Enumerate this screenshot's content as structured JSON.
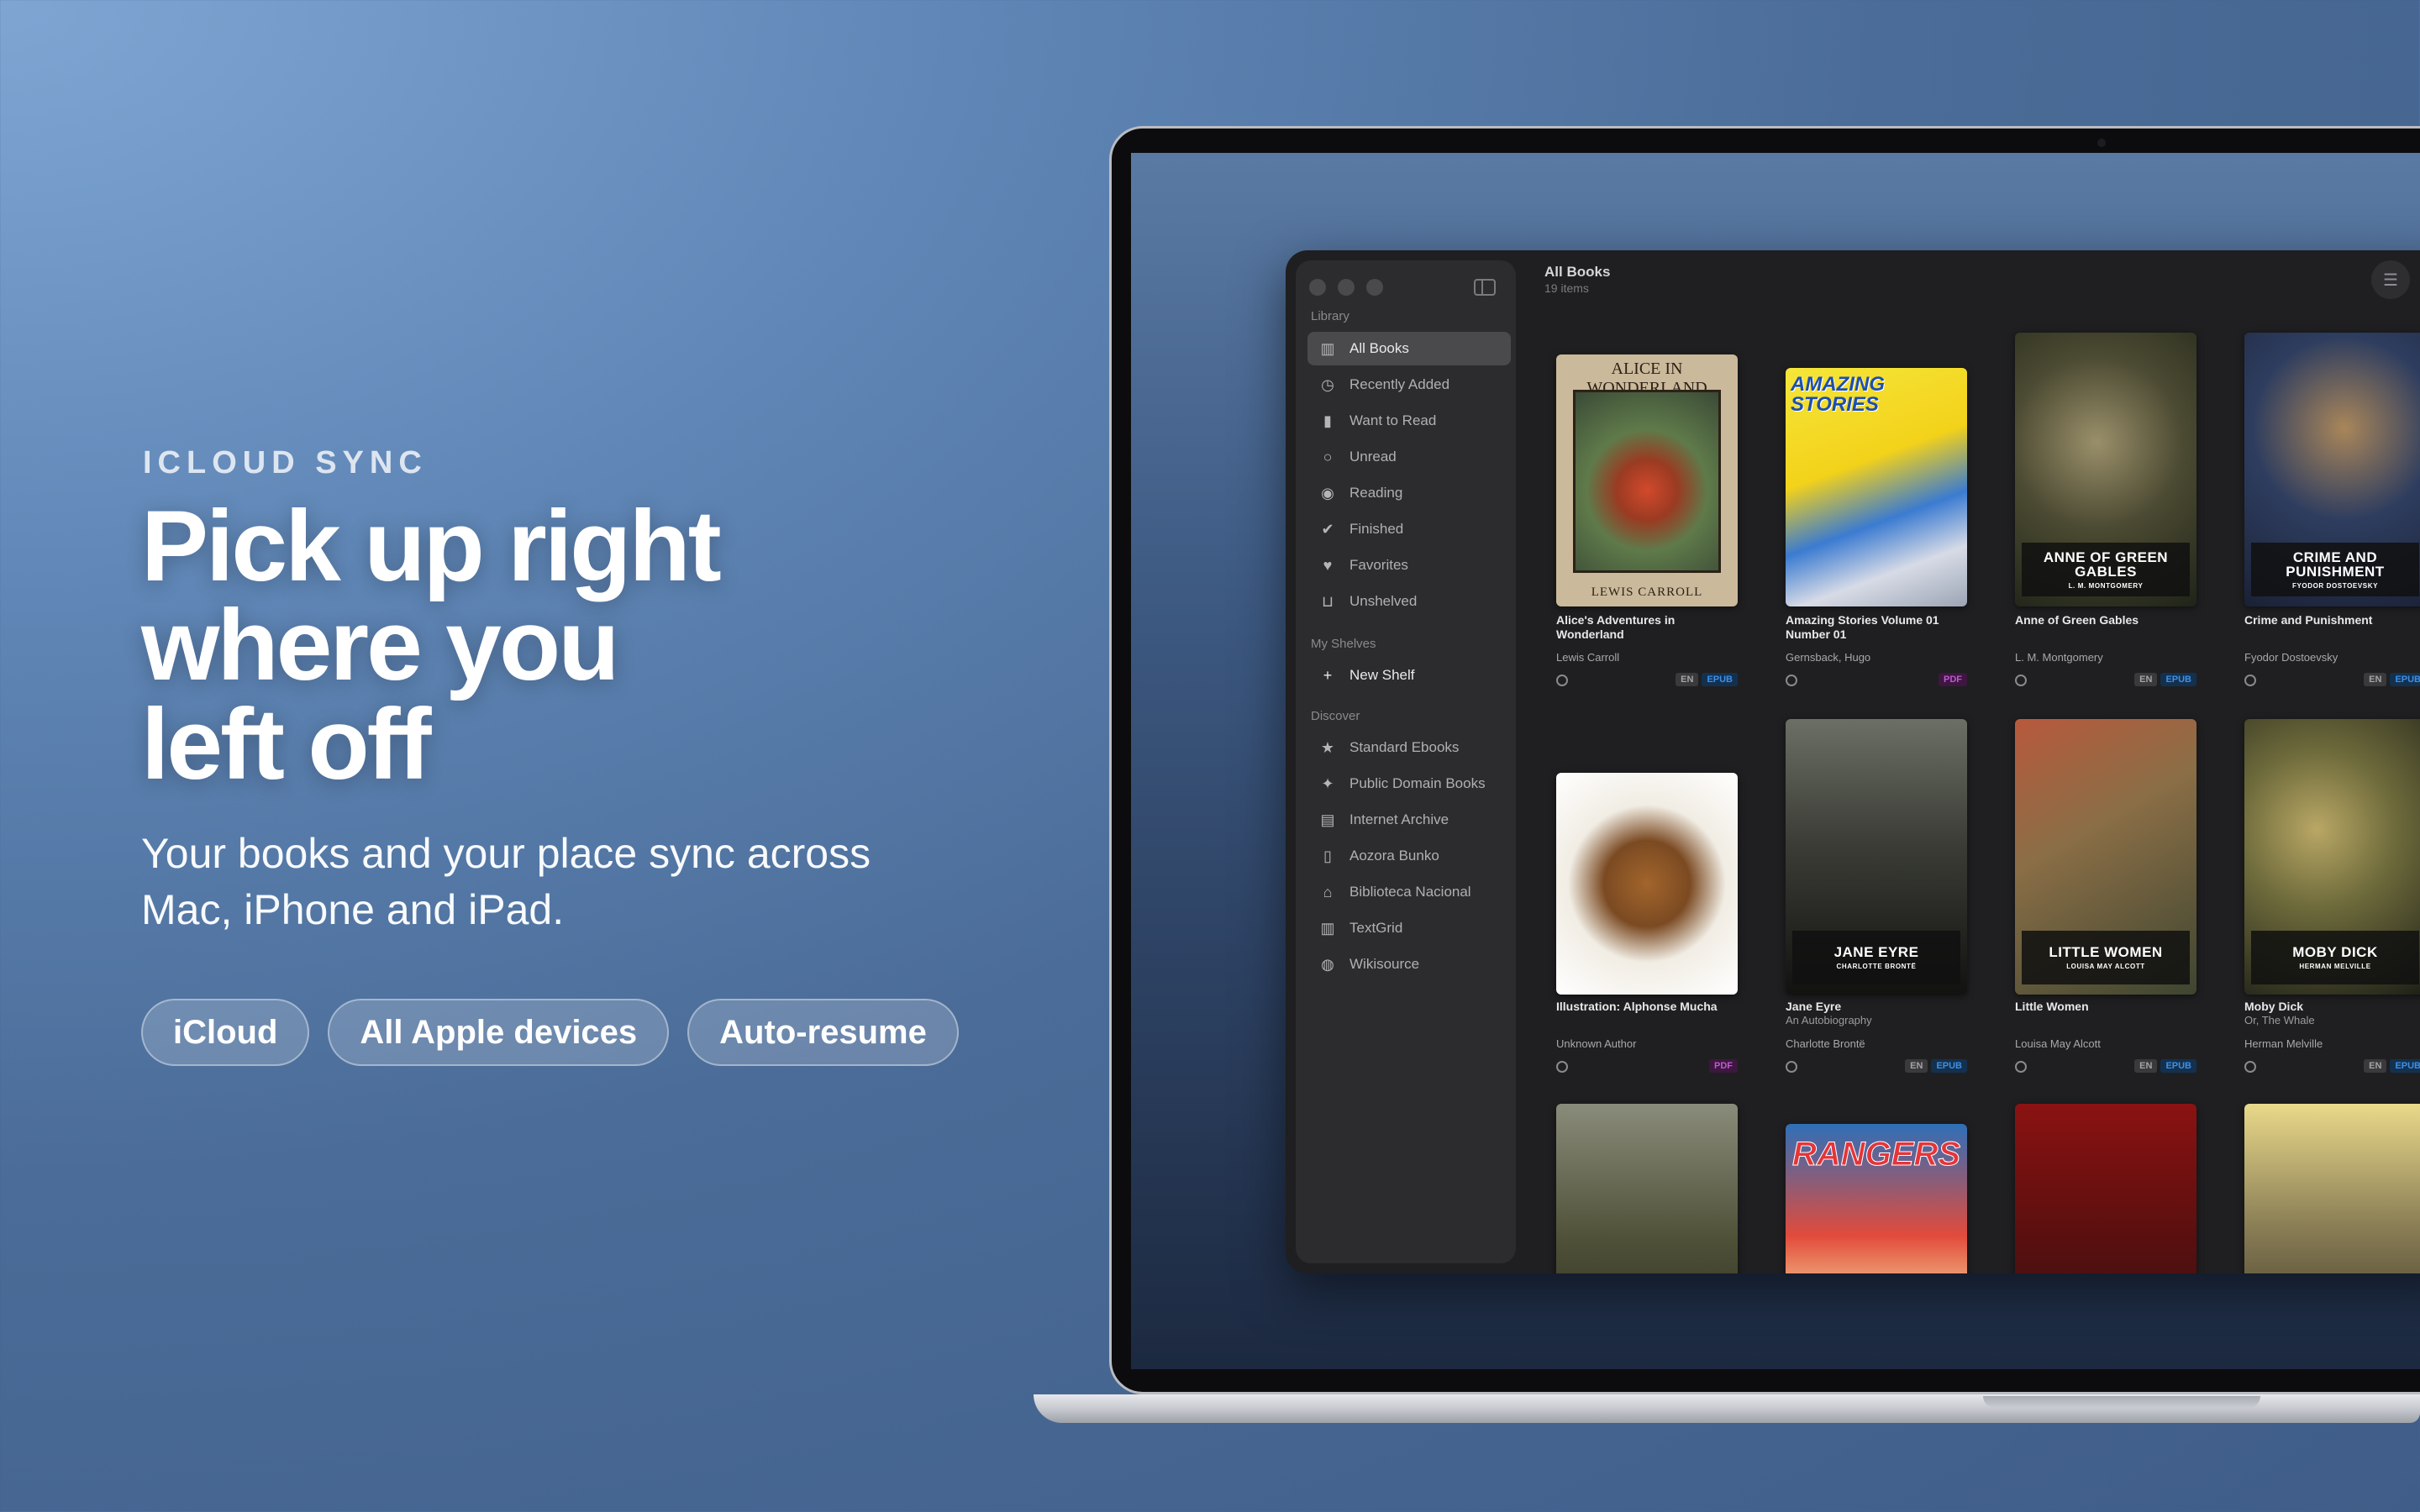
{
  "hero": {
    "eyebrow": "ICLOUD SYNC",
    "headline": [
      "Pick up right",
      "where you",
      "left off"
    ],
    "subtitle": [
      "Your books and your place sync across",
      "Mac, iPhone and iPad."
    ],
    "pills": [
      "iCloud",
      "All Apple devices",
      "Auto-resume"
    ]
  },
  "app": {
    "sidebar": {
      "library_heading": "Library",
      "library_items": [
        {
          "label": "All Books",
          "icon": "books-icon",
          "active": true
        },
        {
          "label": "Recently Added",
          "icon": "clock-icon"
        },
        {
          "label": "Want to Read",
          "icon": "bookmark-icon"
        },
        {
          "label": "Unread",
          "icon": "circle-icon"
        },
        {
          "label": "Reading",
          "icon": "reading-icon"
        },
        {
          "label": "Finished",
          "icon": "checkmark-icon"
        },
        {
          "label": "Favorites",
          "icon": "heart-icon"
        },
        {
          "label": "Unshelved",
          "icon": "tray-icon"
        }
      ],
      "shelves_heading": "My Shelves",
      "new_shelf": "New Shelf",
      "discover_heading": "Discover",
      "discover_items": [
        {
          "label": "Standard Ebooks",
          "icon": "star-icon"
        },
        {
          "label": "Public Domain Books",
          "icon": "sparkles-icon"
        },
        {
          "label": "Internet Archive",
          "icon": "archive-box-icon"
        },
        {
          "label": "Aozora Bunko",
          "icon": "book-icon"
        },
        {
          "label": "Biblioteca Nacional",
          "icon": "building-columns-icon"
        },
        {
          "label": "TextGrid",
          "icon": "library-icon"
        },
        {
          "label": "Wikisource",
          "icon": "globe-icon"
        }
      ]
    },
    "main": {
      "title": "All Books",
      "count": "19 items"
    },
    "books": [
      {
        "title": "Alice's Adventures in Wonderland",
        "subtitle": "",
        "author": "Lewis Carroll",
        "badges": [
          "EN",
          "EPUB"
        ],
        "cover_text": "ALICE IN WONDERLAND",
        "cover_footer": "LEWIS CARROLL"
      },
      {
        "title": "Amazing Stories Volume 01 Number 01",
        "subtitle": "",
        "author": "Gernsback, Hugo",
        "badges": [
          "PDF"
        ],
        "cover_text": "AMAZING STORIES"
      },
      {
        "title": "Anne of Green Gables",
        "subtitle": "",
        "author": "L. M. Montgomery",
        "badges": [
          "EN",
          "EPUB"
        ],
        "cover_text": "ANNE OF GREEN GABLES",
        "cover_author": "L. M. MONTGOMERY"
      },
      {
        "title": "Crime and Punishment",
        "subtitle": "",
        "author": "Fyodor Dostoevsky",
        "badges": [
          "EN",
          "EPUB"
        ],
        "cover_text": "CRIME AND PUNISHMENT",
        "cover_author": "FYODOR DOSTOEVSKY"
      },
      {
        "title": "Illustration: Alphonse Mucha",
        "subtitle": "",
        "author": "Unknown Author",
        "badges": [
          "PDF"
        ]
      },
      {
        "title": "Jane Eyre",
        "subtitle": "An Autobiography",
        "author": "Charlotte Brontë",
        "badges": [
          "EN",
          "EPUB"
        ],
        "cover_text": "JANE EYRE",
        "cover_author": "CHARLOTTE BRONTË"
      },
      {
        "title": "Little Women",
        "subtitle": "",
        "author": "Louisa May Alcott",
        "badges": [
          "EN",
          "EPUB"
        ],
        "cover_text": "LITTLE WOMEN",
        "cover_author": "LOUISA MAY ALCOTT"
      },
      {
        "title": "Moby Dick",
        "subtitle": "Or, The Whale",
        "author": "Herman Melville",
        "badges": [
          "EN",
          "EPUB"
        ],
        "cover_text": "MOBY DICK",
        "cover_author": "HERMAN MELVILLE"
      },
      {
        "title": "",
        "subtitle": "",
        "author": "",
        "badges": []
      },
      {
        "title": "",
        "subtitle": "",
        "author": "",
        "badges": [],
        "cover_text": "RANGERS"
      },
      {
        "title": "",
        "subtitle": "",
        "author": "",
        "badges": []
      },
      {
        "title": "",
        "subtitle": "",
        "author": "",
        "badges": []
      }
    ],
    "colors": {
      "epub": "#3f8fe6",
      "pdf": "#c058cf",
      "window_bg": "#1f1f21",
      "sidebar_bg": "#2c2c2e"
    }
  }
}
